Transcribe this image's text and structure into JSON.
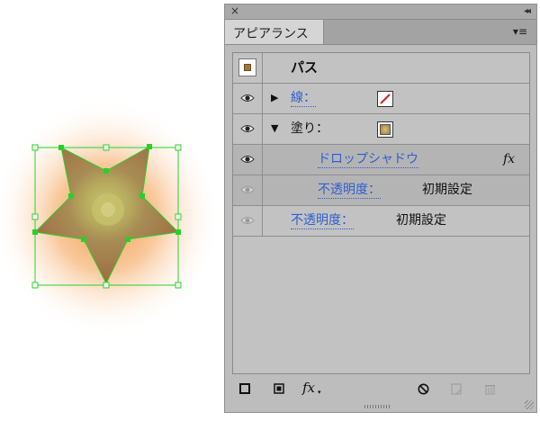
{
  "panel": {
    "close_glyph": "×",
    "collapse_glyph": "◂◂",
    "tab_label": "アピアランス",
    "menu_glyph": "▾≡"
  },
  "rows": {
    "path": {
      "label": "パス"
    },
    "stroke": {
      "label": "線："
    },
    "fill": {
      "label": "塗り："
    },
    "drop_shadow": {
      "label": "ドロップシャドウ",
      "fx": "fx"
    },
    "fill_opacity": {
      "label": "不透明度：",
      "value": "初期設定"
    },
    "opacity": {
      "label": "不透明度：",
      "value": "初期設定"
    }
  },
  "bottom": {
    "fx_label": "fx"
  },
  "colors": {
    "panel_bg": "#bdbdbd",
    "link_blue": "#2f5fd0",
    "selection_green": "#3ed83e",
    "star_fill": "#b08a50",
    "shadow_orange": "#f6a055",
    "stroke_none_red": "#d22020"
  }
}
